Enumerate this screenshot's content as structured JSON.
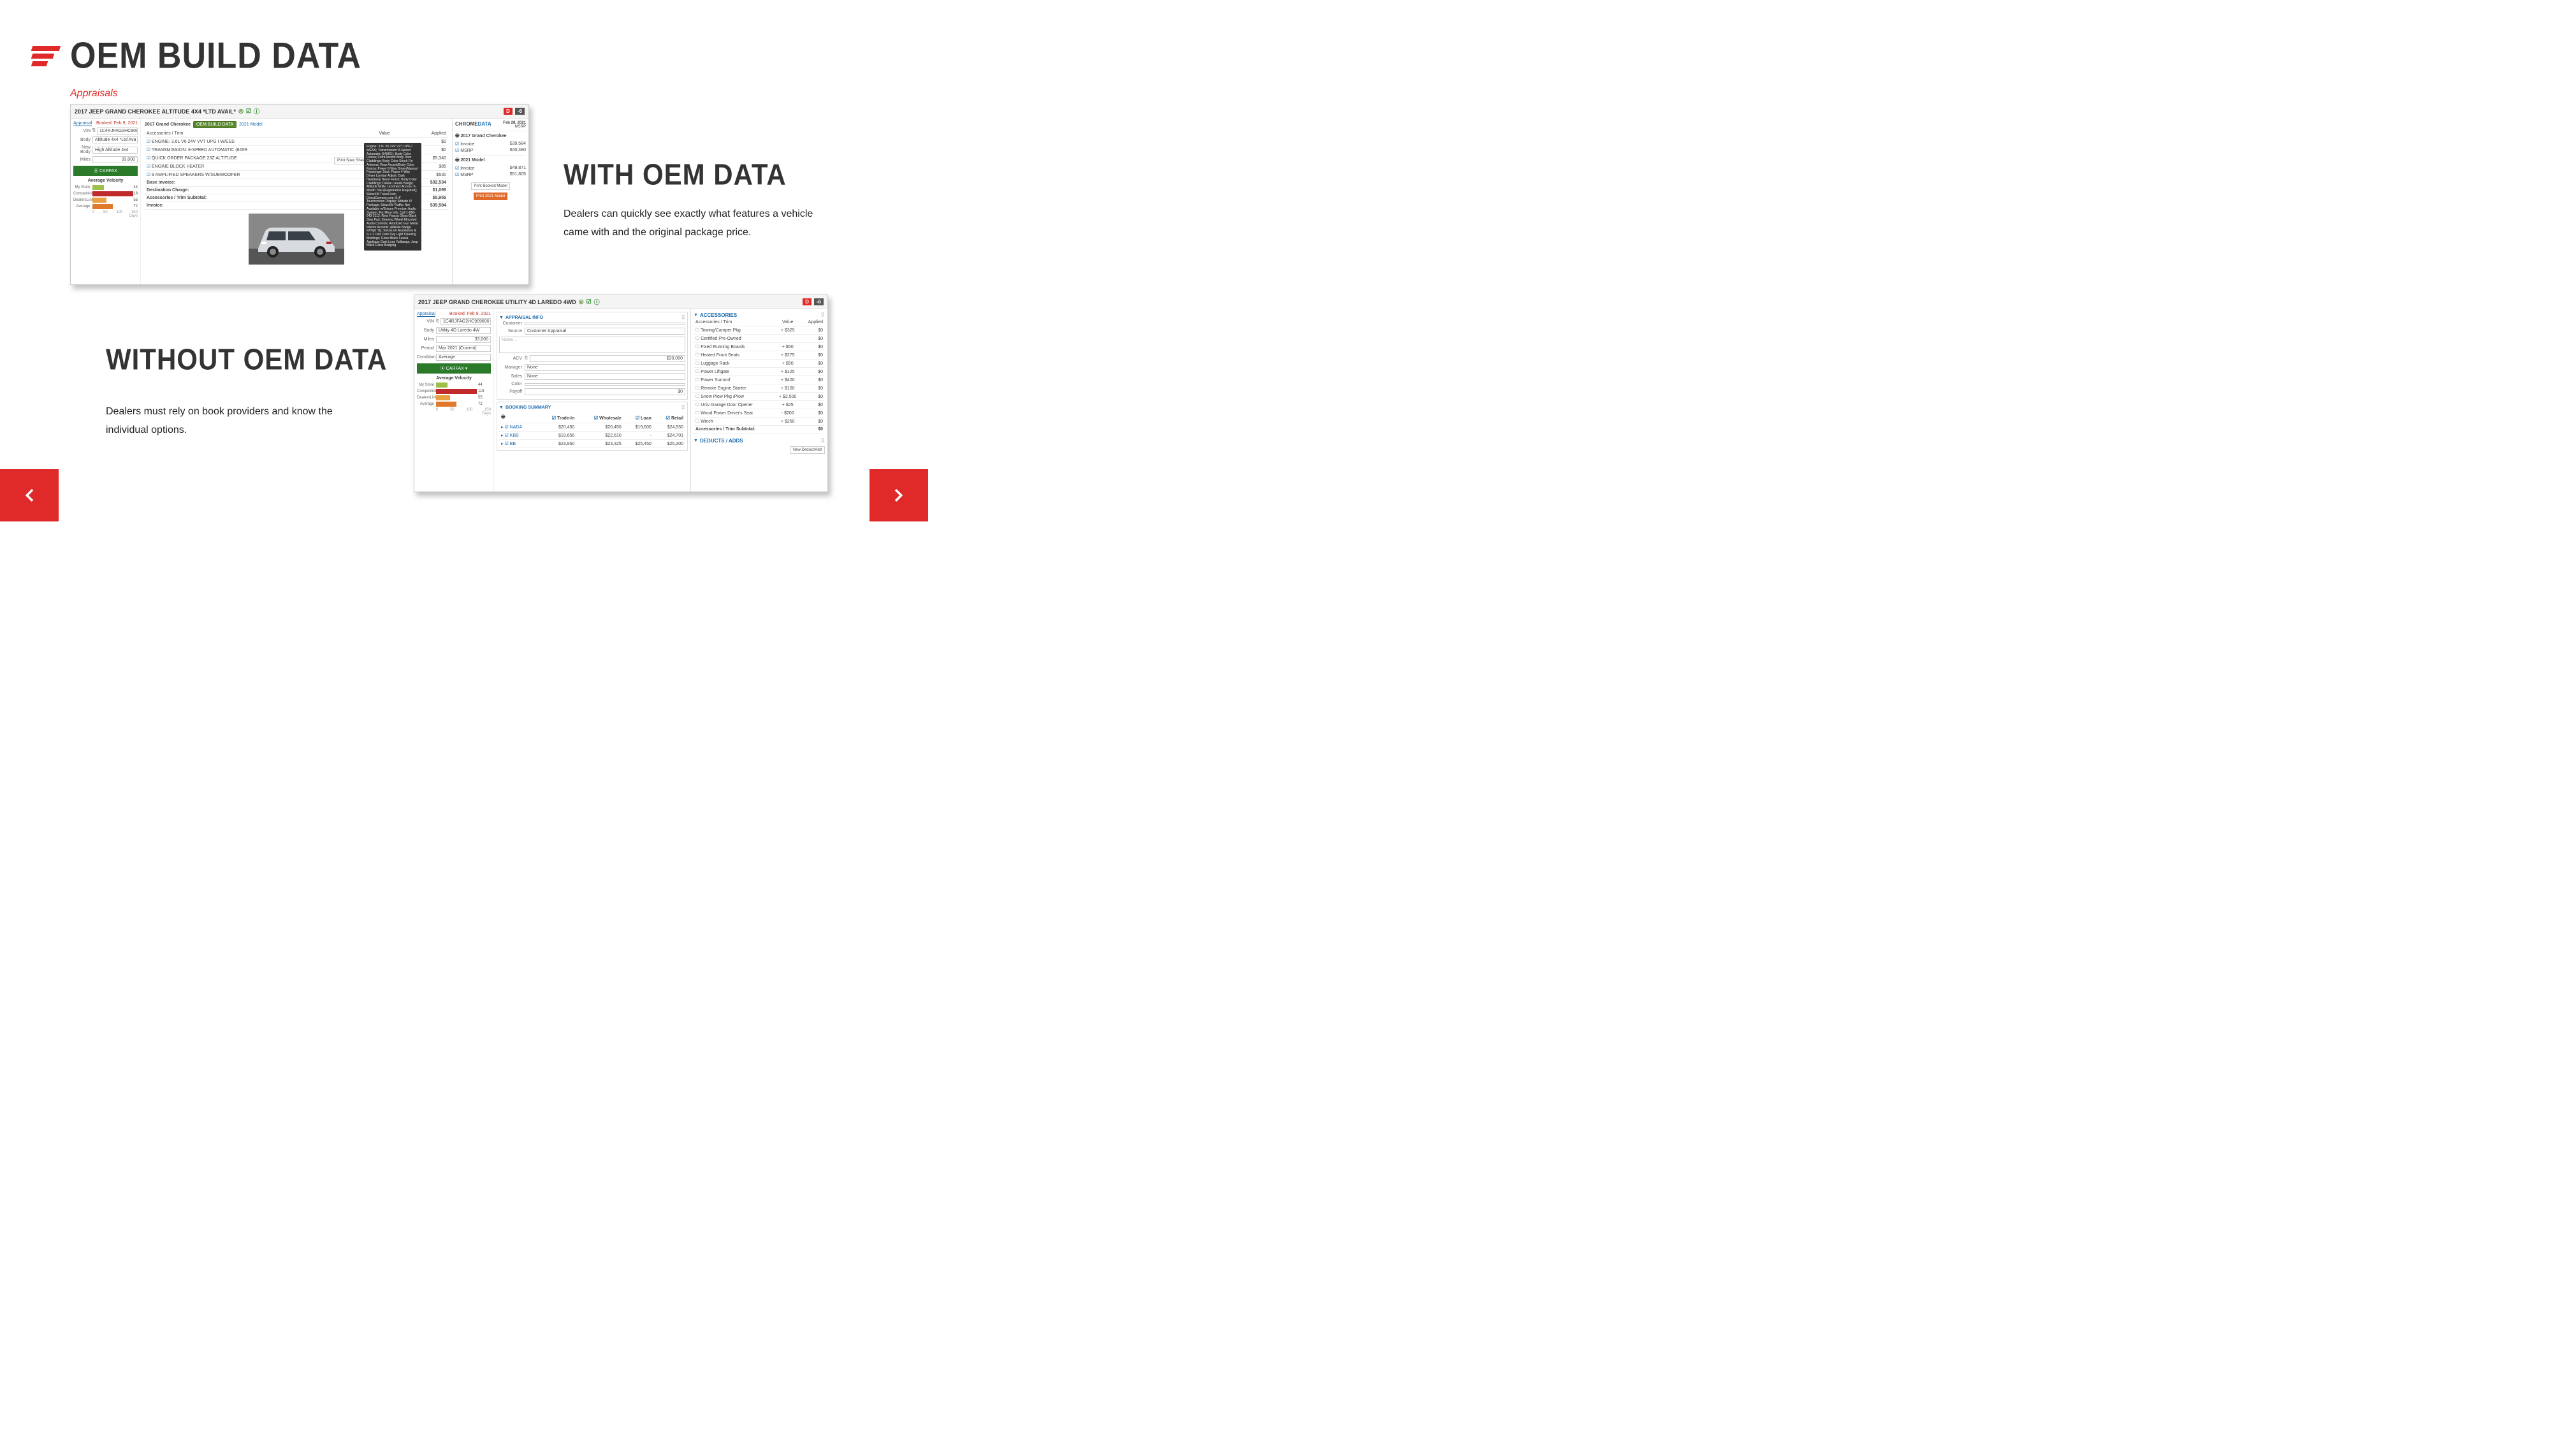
{
  "title": "OEM BUILD DATA",
  "subtitle": "Appraisals",
  "with_heading": "WITH OEM DATA",
  "with_body": "Dealers can quickly see exactly what features a vehicle came with and the original package price.",
  "without_heading": "WITHOUT OEM DATA",
  "without_body": "Dealers must rely on book providers and know the individual options.",
  "shot1": {
    "title": "2017 JEEP GRAND CHEROKEE ALTITUDE 4X4 *LTD AVAIL*",
    "badgeD": "D",
    "badgeN": "-6",
    "tab": "Appraisal",
    "booked": "Booked: Feb 9, 2021",
    "side": {
      "vin_lab": "VIN",
      "vin": "1C4RJFAG2HC909600",
      "body_lab": "Body",
      "body": "Altitude 4x4 *Ltd Ava",
      "newbody_lab": "New Body",
      "newbody": "High Altitude 4x4",
      "miles_lab": "Miles",
      "miles": "33,000",
      "carfax": "CARFAX"
    },
    "velocity_title": "Average Velocity",
    "velocity": [
      {
        "label": "My Store",
        "num": "44",
        "bars": [
          {
            "w": 18,
            "c": "#9cc04a"
          }
        ]
      },
      {
        "label": "Competition",
        "num": "118",
        "bars": [
          {
            "w": 64,
            "c": "#c02a2a"
          }
        ]
      },
      {
        "label": "DealersLink",
        "num": "55",
        "bars": [
          {
            "w": 22,
            "c": "#e8a040"
          }
        ]
      },
      {
        "label": "Average",
        "num": "72",
        "bars": [
          {
            "w": 32,
            "c": "#e07a2a"
          }
        ]
      }
    ],
    "axis": [
      "0",
      "50",
      "100",
      "150"
    ],
    "axis_unit": "Days",
    "main_year": "2017 Grand Cherokee",
    "oem_tag": "OEM BUILD DATA",
    "year_link": "2021 Model",
    "print": "Print Spec Sheet",
    "col_acc": "Accessories / Trim",
    "col_val": "Value",
    "col_app": "Applied",
    "rows": [
      {
        "n": "ENGINE: 3.6L V6 24V VVT UPG I W/ESS",
        "v": "",
        "a": "$0"
      },
      {
        "n": "TRANSMISSION: 8-SPEED AUTOMATIC (845R",
        "v": "",
        "a": "$0"
      },
      {
        "n": "QUICK ORDER PACKAGE 23Z ALTITUDE",
        "v": "+ $5,340",
        "a": "$5,340"
      },
      {
        "n": "ENGINE BLOCK HEATER",
        "v": "+ $85",
        "a": "$85"
      },
      {
        "n": "9 AMPLIFIED SPEAKERS W/SUBWOOFER",
        "v": "+ $530",
        "a": "$530"
      }
    ],
    "tot": [
      {
        "n": "Base Invoice:",
        "a": "$32,534"
      },
      {
        "n": "Destination Charge:",
        "a": "$1,095"
      },
      {
        "n": "Accessories / Trim Subtotal:",
        "a": "$5,955"
      },
      {
        "n": "Invoice:",
        "a": "$39,584"
      }
    ],
    "tooltip": "Engine: 3.6L V6 24V VVT UPG I w/ESS; Transmission: 8-Speed Automatic (845RE); Body Color Fascia; Front Accent Body Door Claddings; Body Color Shark Fin Antenna; Rear Accent/Body Color Fascia; Power 8-Way Driver/Manual Passenger Seat; Power 4-Way Driver Lumbar Adjust; Dark Headlamp Bezel Finish; Body Color Claddings; Delete Laredo Badge; Altitude Grille; Uconnect Access; 6-Month Trial (Registration Required); SiriusXM Travel Link; DirectConnect.com; 8.4\" Touchscreen Display; Altitude IV Package; SiriusXM Traffic; Not Available w/Entune Premium Audio System; For More Info, Call 1-888-643-2112; Rear Fascia Gloss Black Step Pad; Steering Wheel Mounted Audio Controls; Anodized Gun Metal Interior Accents; Altitude Badge w/High Tip; SiriusLink Assistance & 9-1-1 Call; Dark Day Light Opening Moldings; Gloss Black Fascia Applique; Dark Lens Taillamps; Jeep Black Gloss Badging",
    "rpanel": {
      "title_a": "CHROME",
      "title_b": "DATA",
      "date": "Feb 28, 2021",
      "msrp_lab": "MSRP",
      "g1": "2017 Grand Cherokee",
      "r1": [
        {
          "l": "Invoice",
          "v": "$39,584"
        },
        {
          "l": "MSRP",
          "v": "$40,480"
        }
      ],
      "g2": "2021 Model",
      "r2": [
        {
          "l": "Invoice",
          "v": "$49,871"
        },
        {
          "l": "MSRP",
          "v": "$51,805"
        }
      ],
      "btn1": "Print Booked Model",
      "btn2": "Print 2021 Model"
    }
  },
  "shot2": {
    "title": "2017 JEEP GRAND CHEROKEE UTILITY 4D LAREDO 4WD",
    "badgeD": "D",
    "badgeN": "-6",
    "tab": "Appraisal",
    "booked": "Booked: Feb 9, 2021",
    "side": {
      "vin_lab": "VIN",
      "vin": "1C4RJFAG2HC909600",
      "body_lab": "Body",
      "body": "Utility 4D Laredo 4W",
      "miles_lab": "Miles",
      "miles": "33,000",
      "period_lab": "Period",
      "period": "Mar 2021 (Current)",
      "cond_lab": "Condition",
      "cond": "Average",
      "carfax": "CARFAX"
    },
    "velocity_title": "Average Velocity",
    "velocity": [
      {
        "label": "My Store",
        "num": "44",
        "bars": [
          {
            "w": 18,
            "c": "#9cc04a"
          }
        ]
      },
      {
        "label": "Competition",
        "num": "118",
        "bars": [
          {
            "w": 64,
            "c": "#c02a2a"
          }
        ]
      },
      {
        "label": "DealersLink",
        "num": "55",
        "bars": [
          {
            "w": 22,
            "c": "#e8a040"
          }
        ]
      },
      {
        "label": "Average",
        "num": "72",
        "bars": [
          {
            "w": 32,
            "c": "#e07a2a"
          }
        ]
      }
    ],
    "axis": [
      "0",
      "50",
      "100",
      "150"
    ],
    "axis_unit": "Days",
    "appraisal_hdr": "APPRAISAL INFO",
    "form": {
      "customer_lab": "Customer",
      "customer": "",
      "source_lab": "Source",
      "source": "Customer Appraisal",
      "notes_ph": "Notes...",
      "acv_lab": "ACV",
      "acv": "$20,000",
      "manager_lab": "Manager",
      "manager": "None",
      "sales_lab": "Sales",
      "sales": "None",
      "color_lab": "Color",
      "color": "",
      "payoff_lab": "Payoff",
      "payoff": "$0"
    },
    "booking_hdr": "BOOKING SUMMARY",
    "book_cols": [
      "",
      "Trade-In",
      "Wholesale",
      "Loan",
      "Retail"
    ],
    "books": [
      {
        "n": "NADA",
        "v": [
          "$20,450",
          "$20,450",
          "$19,600",
          "$24,550"
        ]
      },
      {
        "n": "KBB",
        "v": [
          "$19,656",
          "$22,610",
          "-",
          "$24,701"
        ]
      },
      {
        "n": "BB",
        "v": [
          "$23,850",
          "$23,325",
          "$25,450",
          "$26,300"
        ]
      }
    ],
    "acc_hdr": "ACCESSORIES",
    "acc_cols": {
      "n": "Accessories / Trim",
      "v": "Value",
      "a": "Applied"
    },
    "acc": [
      {
        "n": "Towing/Camper Pkg",
        "v": "+ $325",
        "a": "$0"
      },
      {
        "n": "Certified Pre-Owned",
        "v": "",
        "a": "$0"
      },
      {
        "n": "Fixed Running Boards",
        "v": "+ $50",
        "a": "$0"
      },
      {
        "n": "Heated Front Seats",
        "v": "+ $275",
        "a": "$0"
      },
      {
        "n": "Luggage Rack",
        "v": "+ $50",
        "a": "$0"
      },
      {
        "n": "Power Liftgate",
        "v": "+ $125",
        "a": "$0"
      },
      {
        "n": "Power Sunroof",
        "v": "+ $400",
        "a": "$0"
      },
      {
        "n": "Remote Engine Starter",
        "v": "+ $100",
        "a": "$0"
      },
      {
        "n": "Snow Plow Pkg /Plow",
        "v": "+ $2,500",
        "a": "$0"
      },
      {
        "n": "Univ Garage Door Opener",
        "v": "+ $25",
        "a": "$0"
      },
      {
        "n": "Wood Power Driver's Seat",
        "v": "- $200",
        "a": "$0"
      },
      {
        "n": "Winch",
        "v": "+ $250",
        "a": "$0"
      }
    ],
    "acc_sub": {
      "n": "Accessories / Trim Subtotal:",
      "a": "$0"
    },
    "deducts_hdr": "DEDUCTS / ADDS",
    "newded": "New Deduct/Add"
  }
}
